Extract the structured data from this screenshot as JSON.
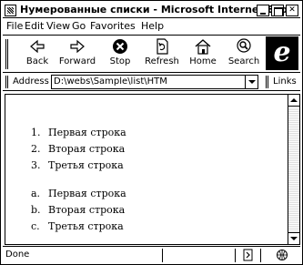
{
  "window": {
    "title": "Нумерованные списки - Microsoft Internet Exp..."
  },
  "menu": {
    "items": [
      {
        "label": "File"
      },
      {
        "label": "Edit"
      },
      {
        "label": "View"
      },
      {
        "label": "Go"
      },
      {
        "label": "Favorites"
      },
      {
        "label": "Help"
      }
    ]
  },
  "toolbar": {
    "back": "Back",
    "forward": "Forward",
    "stop": "Stop",
    "refresh": "Refresh",
    "home": "Home",
    "search": "Search"
  },
  "address": {
    "label": "Address",
    "value": "D:\\webs\\Sample\\list\\HTM",
    "links": "Links"
  },
  "content": {
    "ordered_list": [
      {
        "marker": "1.",
        "text": "Первая строка"
      },
      {
        "marker": "2.",
        "text": "Вторая строка"
      },
      {
        "marker": "3.",
        "text": "Третья строка"
      }
    ],
    "alpha_list": [
      {
        "marker": "a.",
        "text": "Первая строка"
      },
      {
        "marker": "b.",
        "text": "Вторая строка"
      },
      {
        "marker": "c.",
        "text": "Третья строка"
      }
    ]
  },
  "status": {
    "text": "Done"
  },
  "icons": [
    "window-icon",
    "back-icon",
    "forward-icon",
    "stop-icon",
    "refresh-icon",
    "home-icon",
    "search-icon",
    "ie-logo",
    "dropdown-icon",
    "scroll-up-icon",
    "scroll-down-icon",
    "security-icon",
    "zone-icon"
  ]
}
